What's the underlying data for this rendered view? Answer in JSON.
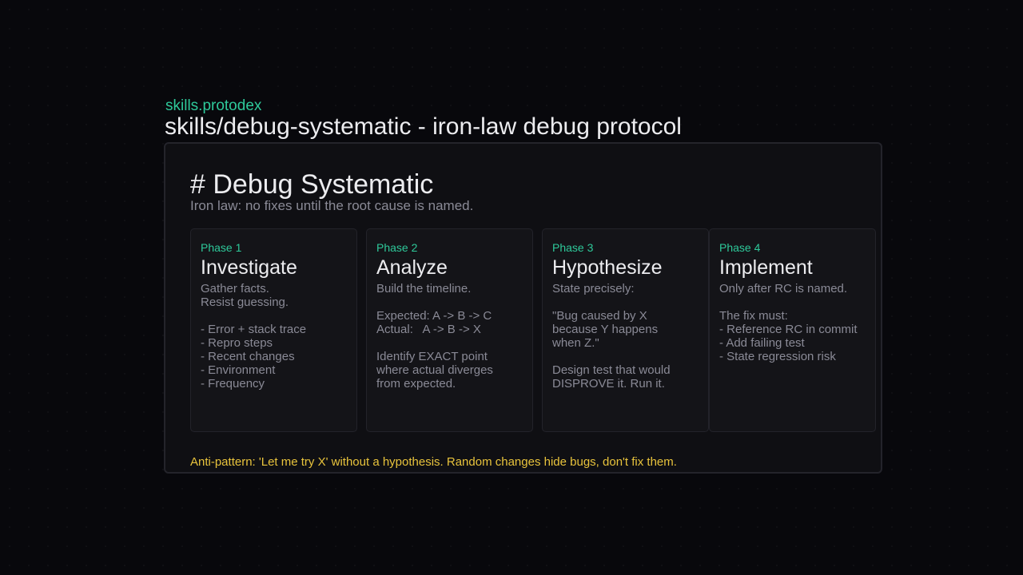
{
  "header": {
    "brand": "skills.protodex",
    "title": "skills/debug-systematic - iron-law debug protocol"
  },
  "doc": {
    "title": "# Debug Systematic",
    "subtitle": "Iron law: no fixes until the root cause is named."
  },
  "phases": [
    {
      "label": "Phase 1",
      "name": "Investigate",
      "body": "Gather facts.\nResist guessing.\n\n- Error + stack trace\n- Repro steps\n- Recent changes\n- Environment\n- Frequency"
    },
    {
      "label": "Phase 2",
      "name": "Analyze",
      "body": "Build the timeline.\n\nExpected: A -> B -> C\nActual:   A -> B -> X\n\nIdentify EXACT point\nwhere actual diverges\nfrom expected."
    },
    {
      "label": "Phase 3",
      "name": "Hypothesize",
      "body": "State precisely:\n\n\"Bug caused by X\nbecause Y happens\nwhen Z.\"\n\nDesign test that would\nDISPROVE it. Run it."
    },
    {
      "label": "Phase 4",
      "name": "Implement",
      "body": "Only after RC is named.\n\nThe fix must:\n- Reference RC in commit\n- Add failing test\n- State regression risk"
    }
  ],
  "anti_pattern": "Anti-pattern: 'Let me try X' without a hypothesis. Random changes hide bugs, don't fix them.",
  "colors": {
    "accent": "#2ec99a",
    "warning": "#e8c33c",
    "background": "#08080c",
    "panel": "#0f0f13"
  }
}
